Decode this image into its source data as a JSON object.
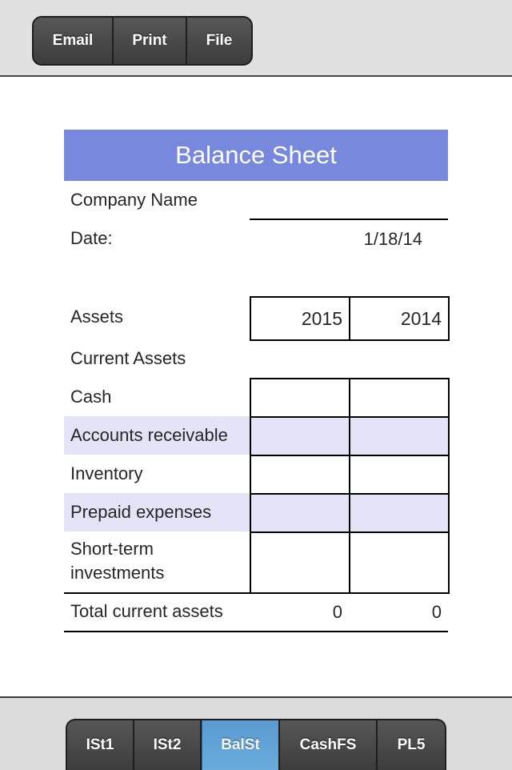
{
  "toolbar": {
    "buttons": [
      {
        "label": "Email"
      },
      {
        "label": "Print"
      },
      {
        "label": "File"
      }
    ]
  },
  "sheet": {
    "title": "Balance Sheet",
    "company_label": "Company Name",
    "company_value": "",
    "date_label": "Date:",
    "date_value": "1/18/14",
    "assets_label": "Assets",
    "years": [
      "2015",
      "2014"
    ],
    "current_assets_label": "Current Assets",
    "rows": [
      {
        "label": "Cash",
        "v2015": "",
        "v2014": ""
      },
      {
        "label": "Accounts receivable",
        "v2015": "",
        "v2014": ""
      },
      {
        "label": "Inventory",
        "v2015": "",
        "v2014": ""
      },
      {
        "label": "Prepaid expenses",
        "v2015": "",
        "v2014": ""
      },
      {
        "label": "Short-term investments",
        "v2015": "",
        "v2014": ""
      }
    ],
    "total": {
      "label": "Total current assets",
      "v2015": "0",
      "v2014": "0"
    },
    "colors": {
      "header": "#7788dd",
      "highlight": "#e3e4f7"
    }
  },
  "tabs": {
    "items": [
      {
        "label": "ISt1"
      },
      {
        "label": "ISt2"
      },
      {
        "label": "BalSt",
        "active": true
      },
      {
        "label": "CashFS"
      },
      {
        "label": "PL5"
      }
    ],
    "active_color": "#5a9ad0"
  }
}
